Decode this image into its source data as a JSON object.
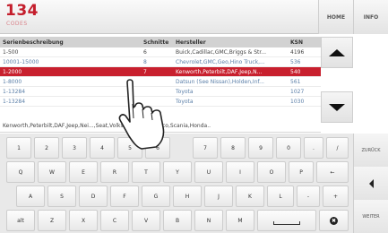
{
  "header": {
    "codes_count": "134",
    "codes_label": "CODES",
    "home_label": "HOME",
    "info_label": "INFO"
  },
  "table": {
    "columns": [
      "Serienbeschreibung",
      "Schnitte",
      "Hersteller",
      "KSN"
    ],
    "rows": [
      {
        "series": "1-500",
        "cuts": "6",
        "maker": "Buick,Cadillac,GMC,Briggs & Str...",
        "ksn": "4196"
      },
      {
        "series": "10001-15000",
        "cuts": "8",
        "maker": "Chevrolet,GMC,Geo,Hino Truck,...",
        "ksn": "536"
      },
      {
        "series": "1-2000",
        "cuts": "7",
        "maker": "Kenworth,Peterbilt,DAF,Jeep,N...",
        "ksn": "540"
      },
      {
        "series": "1-8000",
        "cuts": "",
        "maker": "Datsun (See Nissan),Holden,Inf...",
        "ksn": "561"
      },
      {
        "series": "1-13284",
        "cuts": "",
        "maker": "Toyota",
        "ksn": "1027"
      },
      {
        "series": "1-13284",
        "cuts": "",
        "maker": "Toyota",
        "ksn": "1030"
      }
    ],
    "footer_text": "Kenworth,Peterbilt,DAF,Jeep,Nei...,Seat,Volkswagen,Fiat,Iveco,Scania,Honda..",
    "selected_index": 2
  },
  "keyboard": {
    "row1": [
      "1",
      "2",
      "3",
      "4",
      "5",
      "6",
      "7",
      "8",
      "9",
      "0",
      ".",
      "/"
    ],
    "row2": [
      "Q",
      "W",
      "E",
      "R",
      "T",
      "Y",
      "U",
      "I",
      "O",
      "P",
      "←"
    ],
    "row3": [
      "A",
      "S",
      "D",
      "F",
      "G",
      "H",
      "J",
      "K",
      "L",
      "-",
      "+"
    ],
    "row4": [
      "alt",
      "Z",
      "X",
      "C",
      "V",
      "B",
      "N",
      "M"
    ],
    "delete_symbol": "✖"
  },
  "side": {
    "back_label": "ZURÜCK",
    "next_label": "WEITER"
  },
  "colors": {
    "accent": "#c41e2c",
    "selected_row": "#c8202e",
    "link_text": "#5b7fa8"
  },
  "icons": {
    "scroll_up": "triangle-up-icon",
    "scroll_down": "triangle-down-icon",
    "side_arrow": "triangle-left-icon",
    "pointer": "hand-pointer-icon",
    "delete": "delete-circle-icon",
    "space": "space-bar-icon"
  }
}
